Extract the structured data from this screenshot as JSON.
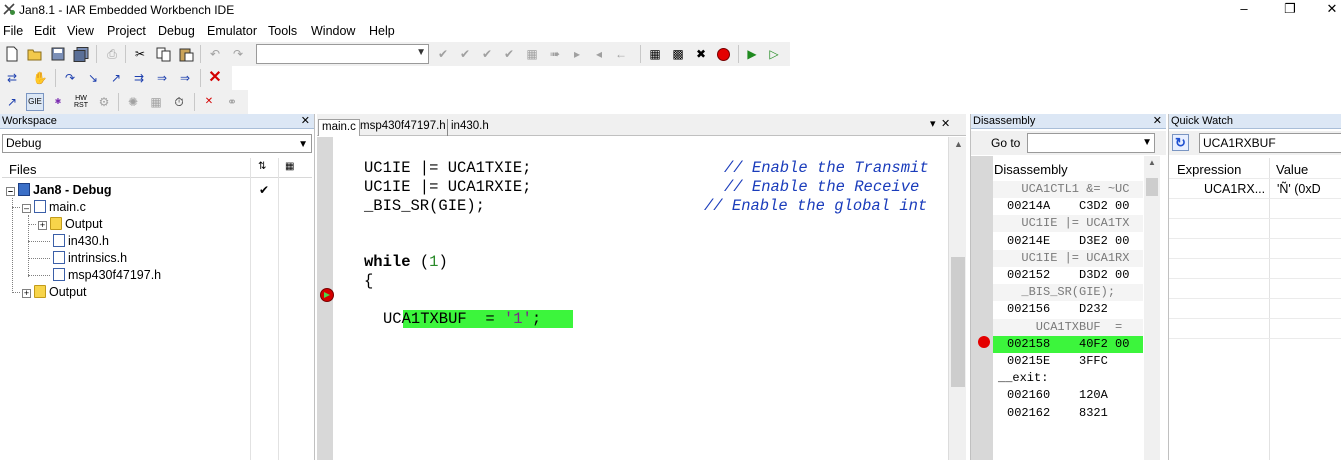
{
  "window": {
    "title": "Jan8.1 - IAR Embedded Workbench IDE"
  },
  "menu": [
    "File",
    "Edit",
    "View",
    "Project",
    "Debug",
    "Emulator",
    "Tools",
    "Window",
    "Help"
  ],
  "toolbar3": {
    "gie_label": "GIE",
    "hw_label": "HW",
    "rst_label": "RST"
  },
  "workspace": {
    "header": "Workspace",
    "config": "Debug",
    "files_label": "Files",
    "tree": {
      "project": "Jan8 - Debug",
      "main_c": "main.c",
      "output_sub": "Output",
      "in430": "in430.h",
      "intrinsics": "intrinsics.h",
      "msp": "msp430f47197.h",
      "output": "Output"
    }
  },
  "editor": {
    "tabs": [
      "main.c",
      "msp430f47197.h",
      "in430.h"
    ],
    "lines": {
      "l1_code": "UC1IE |= UCA1TXIE;",
      "l1_comment": "// Enable the Transmit",
      "l2_code": "UC1IE |= UCA1RXIE;",
      "l2_comment": "// Enable the Receive",
      "l3_code": "_BIS_SR(GIE);",
      "l3_comment": "// Enable the global int",
      "while_kw": "while",
      "while_open": " (",
      "while_num": "1",
      "while_close": ")",
      "brace": "{",
      "current_code": "UCA1TXBUF  = ",
      "current_str": "'1'",
      "current_end": ";"
    }
  },
  "disassembly": {
    "header": "Disassembly",
    "goto_label": "Go to",
    "column_header": "Disassembly",
    "lines": [
      {
        "text": "  UCA1CTL1 &= ~UC",
        "kind": "src"
      },
      {
        "text": "00214A    C3D2 00",
        "kind": "asm"
      },
      {
        "text": "  UC1IE |= UCA1TX",
        "kind": "src"
      },
      {
        "text": "00214E    D3E2 00",
        "kind": "asm"
      },
      {
        "text": "  UC1IE |= UCA1RX",
        "kind": "src"
      },
      {
        "text": "002152    D3D2 00",
        "kind": "asm"
      },
      {
        "text": "  _BIS_SR(GIE);",
        "kind": "src"
      },
      {
        "text": "002156    D232",
        "kind": "asm"
      },
      {
        "text": "    UCA1TXBUF  =",
        "kind": "src"
      },
      {
        "text": "002158    40F2 00",
        "kind": "cur"
      },
      {
        "text": "00215E    3FFC",
        "kind": "asm"
      },
      {
        "text": "__exit:",
        "kind": "label"
      },
      {
        "text": "002160    120A",
        "kind": "asm"
      },
      {
        "text": "002162    8321",
        "kind": "asm"
      }
    ]
  },
  "quickwatch": {
    "header": "Quick Watch",
    "expression_input": "UCA1RXBUF",
    "col_expression": "Expression",
    "col_value": "Value",
    "row_expression": "UCA1RX...",
    "row_value": "'Ñ' (0xD"
  }
}
